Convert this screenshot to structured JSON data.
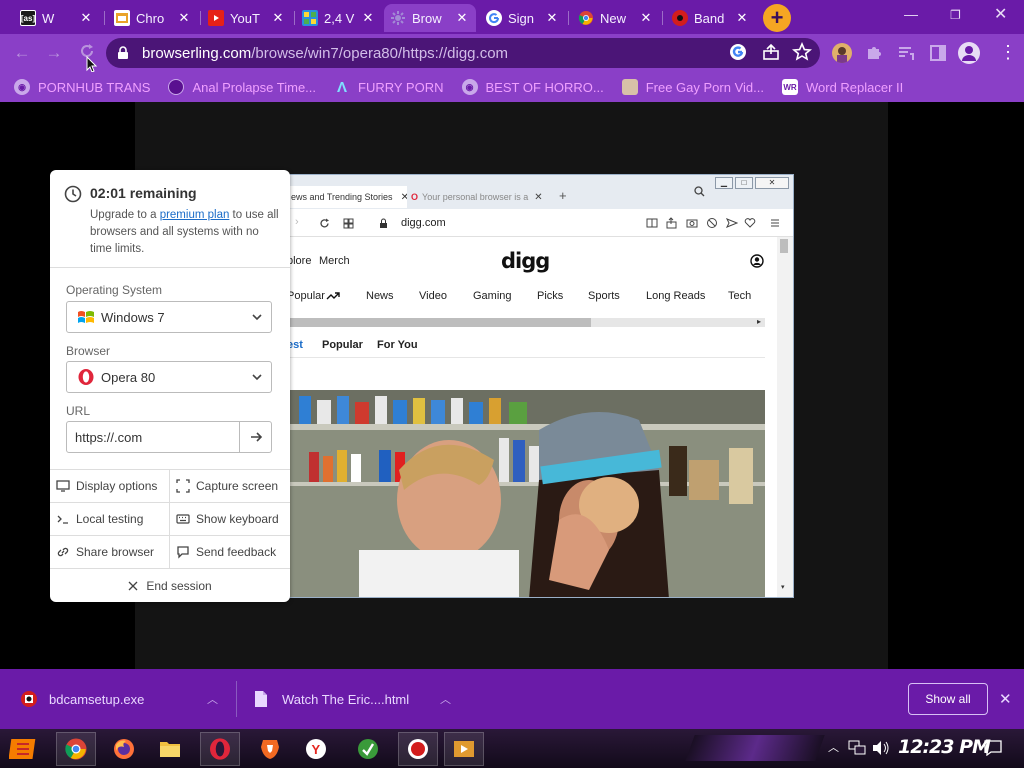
{
  "tabs": [
    {
      "title": "W",
      "favicon": "lastfm-icon",
      "color": "#1a1a1a"
    },
    {
      "title": "Chro",
      "favicon": "chrome-web-icon",
      "color": "#e9a32a"
    },
    {
      "title": "YouT",
      "favicon": "youtube-icon",
      "color": "#e62117"
    },
    {
      "title": "2,4 V",
      "favicon": "grid-app-icon",
      "color": "#2a8ee0"
    },
    {
      "title": "Brow",
      "favicon": "browserling-icon",
      "color": "#a38ad6",
      "active": true
    },
    {
      "title": "Sign",
      "favicon": "google-icon",
      "color": "#ffffff"
    },
    {
      "title": "New",
      "favicon": "chrome-icon",
      "color": "#f0c23a"
    },
    {
      "title": "Band",
      "favicon": "bandicam-icon",
      "color": "#d31d1d"
    }
  ],
  "omnibox": {
    "domain": "browserling.com",
    "path": "/browse/win7/opera80/https://digg.com"
  },
  "bookmarks": [
    {
      "label": "PORNHUB TRANS",
      "icon": "globe-icon"
    },
    {
      "label": "Anal Prolapse Time...",
      "icon": "site-icon"
    },
    {
      "label": "FURRY PORN",
      "icon": "a-logo-icon"
    },
    {
      "label": "BEST OF HORRO...",
      "icon": "globe-icon"
    },
    {
      "label": "Free Gay Porn Vid...",
      "icon": "site-icon"
    },
    {
      "label": "Word Replacer II",
      "icon": "wr-extension-icon"
    }
  ],
  "panel": {
    "timer": "02:01 remaining",
    "desc_pre": "Upgrade to a ",
    "desc_link": "premium plan",
    "desc_post": " to use all browsers and all systems with no time limits.",
    "os_label": "Operating System",
    "os_value": "Windows 7",
    "browser_label": "Browser",
    "browser_value": "Opera 80",
    "url_label": "URL",
    "url_value": "https://.com",
    "actions": {
      "display": "Display options",
      "capture": "Capture screen",
      "local": "Local testing",
      "keyboard": "Show keyboard",
      "share": "Share browser",
      "feedback": "Send feedback"
    },
    "end": "End session"
  },
  "remote": {
    "tab1": "ews and Trending Stories",
    "tab2": "Your personal browser is a",
    "url": "digg.com",
    "logo": "digg",
    "nav_top": [
      "plore",
      "Merch"
    ],
    "categories": [
      "Popular",
      "News",
      "Video",
      "Gaming",
      "Picks",
      "Sports",
      "Long Reads",
      "Tech"
    ],
    "subtabs": [
      "est",
      "Popular",
      "For You"
    ]
  },
  "downloads": [
    {
      "name": "bdcamsetup.exe"
    },
    {
      "name": "Watch The Eric....html"
    }
  ],
  "show_all": "Show all",
  "clock": "12:23 PM"
}
